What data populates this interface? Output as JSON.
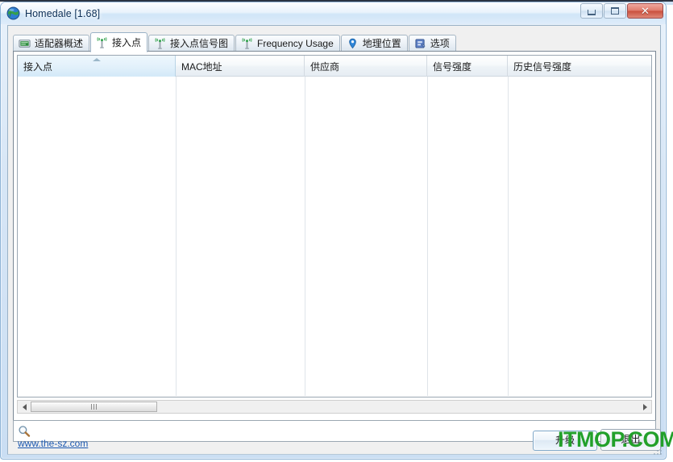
{
  "window": {
    "title": "Homedale [1.68]",
    "icon": "globe-icon",
    "controls": {
      "minimize": "minimize-button",
      "maximize": "maximize-button",
      "close": "close-button",
      "close_glyph": "✕"
    }
  },
  "tabs": [
    {
      "id": "adapter-overview",
      "label": "适配器概述",
      "icon": "network-card-icon",
      "active": false
    },
    {
      "id": "access-points",
      "label": "接入点",
      "icon": "antenna-green-icon",
      "active": true
    },
    {
      "id": "ap-signal-graph",
      "label": "接入点信号图",
      "icon": "antenna-green-icon",
      "active": false
    },
    {
      "id": "frequency-usage",
      "label": "Frequency Usage",
      "icon": "antenna-green-icon",
      "active": false
    },
    {
      "id": "geolocation",
      "label": "地理位置",
      "icon": "map-pin-icon",
      "active": false
    },
    {
      "id": "options",
      "label": "选项",
      "icon": "options-icon",
      "active": false
    }
  ],
  "list": {
    "columns": [
      {
        "label": "接入点",
        "width": 196,
        "sorted": true,
        "sort_dir": "asc"
      },
      {
        "label": "MAC地址",
        "width": 160,
        "sorted": false,
        "sort_dir": ""
      },
      {
        "label": "供应商",
        "width": 152,
        "sorted": false,
        "sort_dir": ""
      },
      {
        "label": "信号强度",
        "width": 100,
        "sorted": false,
        "sort_dir": ""
      },
      {
        "label": "历史信号强度",
        "width": 178,
        "sorted": false,
        "sort_dir": ""
      }
    ],
    "rows": []
  },
  "scrollbar": {
    "left_arrow": "scroll-left-arrow",
    "right_arrow": "scroll-right-arrow",
    "thumb": "scroll-thumb"
  },
  "search": {
    "icon": "magnifier-icon",
    "value": "",
    "placeholder": ""
  },
  "footer": {
    "link": "www.the-sz.com",
    "upgrade_label": "升级",
    "exit_label": "退出"
  },
  "watermark": {
    "text": "ITMOP.COM",
    "color": "#22a02a"
  },
  "colors": {
    "accent": "#1b58b0",
    "window_chrome": "#cadef3",
    "tab_active_bg": "#ffffff",
    "sorted_column_bg": "#e3f1fb",
    "green_icon": "#2fa14a"
  }
}
